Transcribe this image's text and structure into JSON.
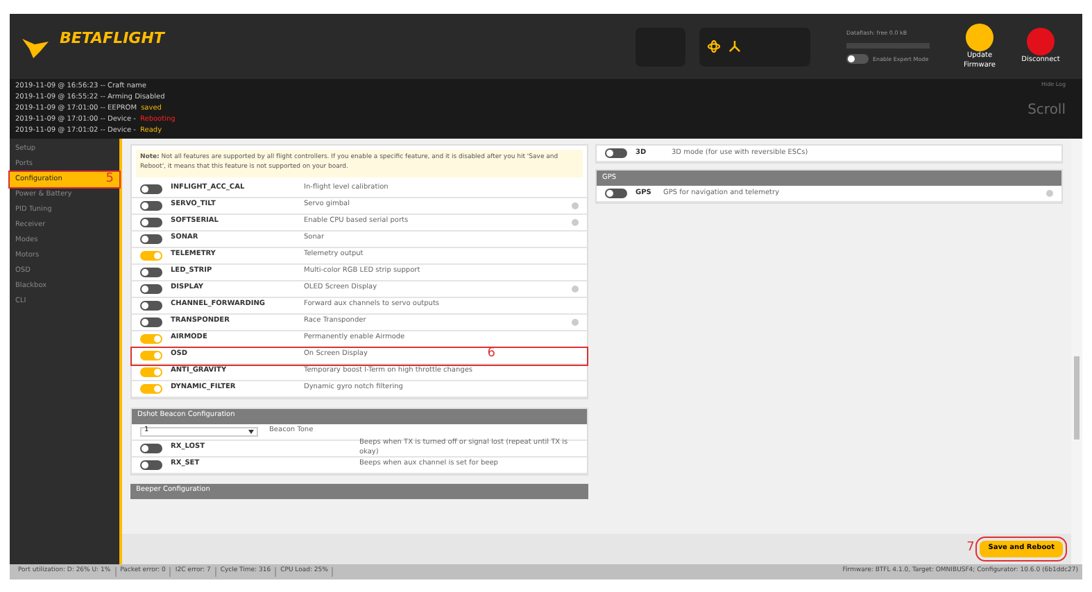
{
  "header": {
    "logo": "BETAFLIGHT",
    "expert_mode": {
      "label": "Enable Expert Mode",
      "on": false
    },
    "dataflash_label": "Dataflash: free 0.0 kB",
    "update": "Update Firmware",
    "disconnect": "Disconnect"
  },
  "log": [
    {
      "time": "2019-11-09 @ 16:56:23",
      "text": "-- Craft name"
    },
    {
      "time": "2019-11-09 @ 16:55:22",
      "text": "-- Arming Disabled"
    },
    {
      "time": "2019-11-09 @ 17:01:00",
      "text": "-- EEPROM",
      "status": "saved",
      "color": "#f5b800"
    },
    {
      "time": "2019-11-09 @ 17:01:00",
      "text": "-- Device -",
      "status": "Rebooting",
      "color": "#ff2020"
    },
    {
      "time": "2019-11-09 @ 17:01:02",
      "text": "-- Device -",
      "status": "Ready",
      "color": "#f5b800"
    }
  ],
  "log_side": {
    "hide": "Hide Log",
    "scroll": "Scroll"
  },
  "sidebar": {
    "items": [
      {
        "label": "Setup",
        "selected": false
      },
      {
        "label": "Ports",
        "selected": false
      },
      {
        "label": "Configuration",
        "selected": true,
        "annotation": "5"
      },
      {
        "label": "Power & Battery",
        "selected": false
      },
      {
        "label": "PID Tuning",
        "selected": false
      },
      {
        "label": "Receiver",
        "selected": false
      },
      {
        "label": "Modes",
        "selected": false
      },
      {
        "label": "Motors",
        "selected": false
      },
      {
        "label": "OSD",
        "selected": false
      },
      {
        "label": "Blackbox",
        "selected": false
      },
      {
        "label": "CLI",
        "selected": false
      }
    ]
  },
  "note": "**Note:** Not all features are supported by all flight controllers. If you enable a specific feature, and it is disabled after you hit 'Save and Reboot', it means that this feature is not supported on your board.",
  "features": [
    {
      "name": "INFLIGHT_ACC_CAL",
      "desc": "In-flight level calibration",
      "on": false,
      "help": false
    },
    {
      "name": "SERVO_TILT",
      "desc": "Servo gimbal",
      "on": false,
      "help": true
    },
    {
      "name": "SOFTSERIAL",
      "desc": "Enable CPU based serial ports",
      "on": false,
      "help": true
    },
    {
      "name": "SONAR",
      "desc": "Sonar",
      "on": false,
      "help": false
    },
    {
      "name": "TELEMETRY",
      "desc": "Telemetry output",
      "on": true,
      "help": false
    },
    {
      "name": "LED_STRIP",
      "desc": "Multi-color RGB LED strip support",
      "on": false,
      "help": false
    },
    {
      "name": "DISPLAY",
      "desc": "OLED Screen Display",
      "on": false,
      "help": true
    },
    {
      "name": "CHANNEL_FORWARDING",
      "desc": "Forward aux channels to servo outputs",
      "on": false,
      "help": false
    },
    {
      "name": "TRANSPONDER",
      "desc": "Race Transponder",
      "on": false,
      "help": true
    },
    {
      "name": "AIRMODE",
      "desc": "Permanently enable Airmode",
      "on": true,
      "help": false
    },
    {
      "name": "OSD",
      "desc": "On Screen Display",
      "on": true,
      "help": false,
      "highlighted": true,
      "annotation": "6"
    },
    {
      "name": "ANTI_GRAVITY",
      "desc": "Temporary boost I-Term on high throttle changes",
      "on": true,
      "help": false
    },
    {
      "name": "DYNAMIC_FILTER",
      "desc": "Dynamic gyro notch filtering",
      "on": true,
      "help": false
    }
  ],
  "right_features": [
    {
      "name": "3D",
      "desc": "3D mode (for use with reversible ESCs)",
      "on": false,
      "help": false
    }
  ],
  "gps": {
    "title": "GPS",
    "features": [
      {
        "name": "GPS",
        "desc": "GPS for navigation and telemetry",
        "on": false,
        "help": true
      }
    ]
  },
  "dshot": {
    "title": "Dshot Beacon Configuration",
    "select_value": "1",
    "select_label": "Beacon Tone",
    "rows": [
      {
        "name": "RX_LOST",
        "desc": "Beeps when TX is turned off or signal lost (repeat until TX is okay)",
        "on": false
      },
      {
        "name": "RX_SET",
        "desc": "Beeps when aux channel is set for beep",
        "on": false
      }
    ]
  },
  "beeper": {
    "title": "Beeper Configuration"
  },
  "save": {
    "label": "Save and Reboot",
    "annotation": "7"
  },
  "status_bar": [
    "Port utilization: D: 26% U: 1%",
    "Packet error: 0",
    "I2C error: 7",
    "Cycle Time: 316",
    "CPU Load: 25%"
  ],
  "firmware": "Firmware: BTFL 4.1.0, Target: OMNIBUSF4; Configurator: 10.6.0 (6b1ddc27)"
}
